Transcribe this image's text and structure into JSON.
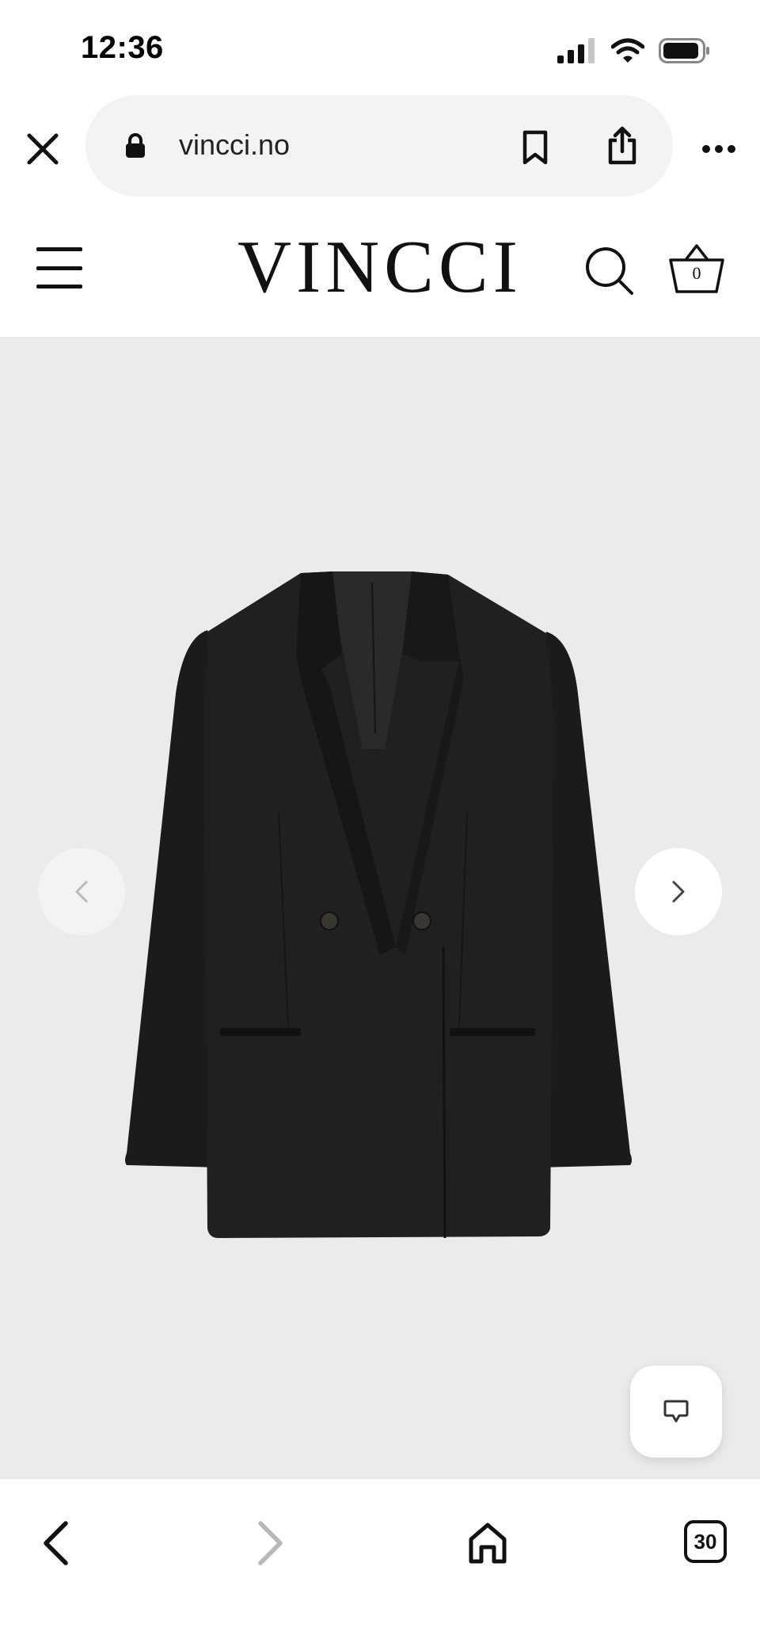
{
  "status_bar": {
    "time": "12:36",
    "icons": [
      "signal-icon",
      "wifi-icon",
      "battery-icon"
    ]
  },
  "browser": {
    "url": "vincci.no",
    "icons": [
      "close-icon",
      "lock-icon",
      "bookmark-icon",
      "share-icon",
      "more-icon"
    ]
  },
  "site_header": {
    "logo": "VINCCI",
    "basket_count": "0",
    "icons": [
      "hamburger-menu-icon",
      "search-icon",
      "basket-icon"
    ]
  },
  "gallery": {
    "product": "black double-breasted blazer",
    "icons": [
      "chevron-left-icon",
      "chevron-right-icon",
      "chat-icon"
    ]
  },
  "bottom_bar": {
    "tab_count": "30",
    "icons": [
      "back-arrow-icon",
      "forward-arrow-icon",
      "home-icon",
      "tabs-icon"
    ]
  },
  "colors": {
    "gallery_background": "#ebebeb",
    "url_pill_background": "#f1f3f4",
    "disabled_icon": "#b8b8b8",
    "text": "#111111"
  }
}
